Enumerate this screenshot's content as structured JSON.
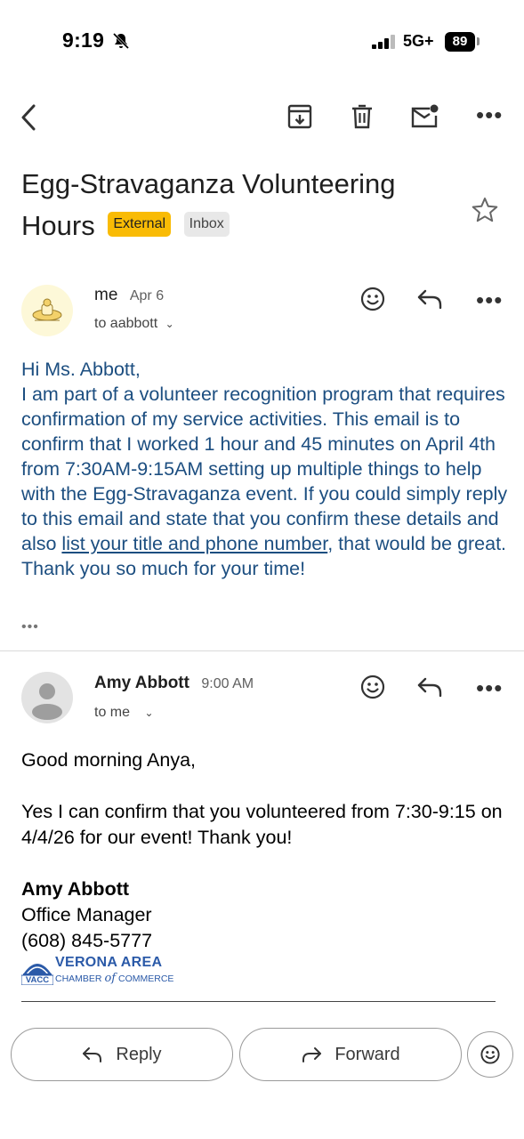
{
  "status_bar": {
    "time": "9:19",
    "network": "5G+",
    "battery": "89"
  },
  "subject": {
    "title": "Egg-Stravaganza Volunteering Hours",
    "badge_external": "External",
    "badge_inbox": "Inbox"
  },
  "message1": {
    "sender": "me",
    "date": "Apr 6",
    "recipient": "to aabbott",
    "greeting": "Hi Ms. Abbott,",
    "body_before_link": "I am part of a volunteer recognition program that requires confirmation of my service activities. This email is to confirm that I worked 1 hour and 45 minutes on April 4th from 7:30AM-9:15AM setting up multiple things to help with the Egg-Stravaganza event. If you could simply reply to this email and state that you confirm these details and also ",
    "link_text": "list your title and phone number",
    "body_after_link": ", that would be great. Thank you so much for your time!"
  },
  "message2": {
    "sender": "Amy Abbott",
    "time": "9:00 AM",
    "recipient": "to me",
    "greeting": "Good morning Anya,",
    "body": "Yes I can confirm that you volunteered from 7:30-9:15 on 4/4/26 for our event! Thank you!",
    "signature_name": "Amy Abbott",
    "signature_title": "Office Manager",
    "signature_phone": "(608) 845-5777",
    "logo_line1": "VERONA AREA",
    "logo_line2a": "CHAMBER",
    "logo_line2b": "of",
    "logo_line2c": "COMMERCE",
    "logo_abbr": "VACC"
  },
  "actions": {
    "reply_label": "Reply",
    "forward_label": "Forward"
  },
  "colors": {
    "link_blue": "#1c4e80",
    "external_badge": "#f9bb05"
  }
}
